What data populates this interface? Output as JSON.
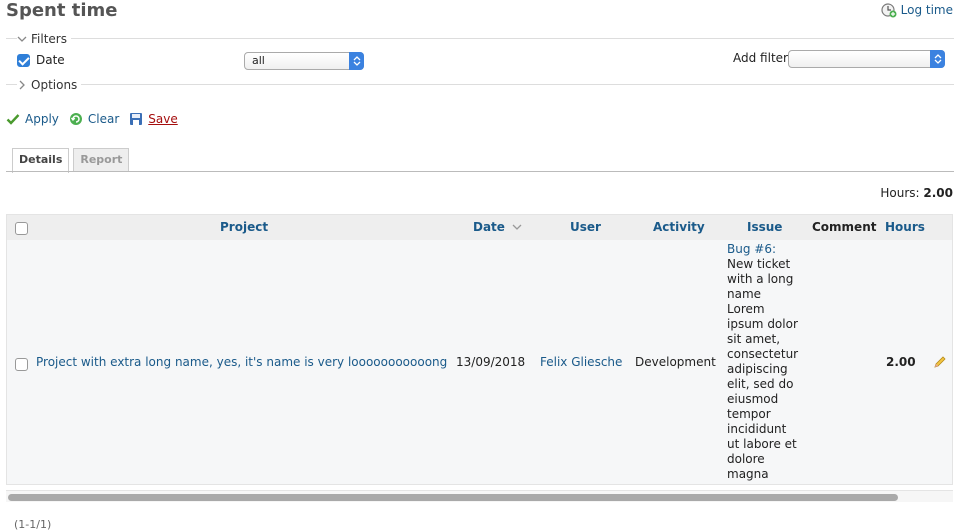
{
  "page": {
    "title": "Spent time",
    "log_time_label": "Log time"
  },
  "filters": {
    "legend": "Filters",
    "date_label": "Date",
    "date_checked": true,
    "date_operator": "all",
    "add_filter_label": "Add filter",
    "add_filter_value": ""
  },
  "options": {
    "legend": "Options"
  },
  "actions": {
    "apply": "Apply",
    "clear": "Clear",
    "save": "Save"
  },
  "tabs": [
    {
      "label": "Details",
      "active": true
    },
    {
      "label": "Report",
      "active": false
    }
  ],
  "total": {
    "label": "Hours:",
    "value": "2.00"
  },
  "table": {
    "columns": [
      "Project",
      "Date",
      "User",
      "Activity",
      "Issue",
      "Comment",
      "Hours"
    ],
    "rows": [
      {
        "project": "Project with extra long name, yes, it's name is very looooooooooong",
        "date": "13/09/2018",
        "user": "Felix Gliesche",
        "activity": "Development",
        "issue_link": "Bug #6:",
        "issue_lines": [
          "New ticket",
          "with a long",
          "name",
          "Lorem",
          "ipsum dolor",
          "sit amet,",
          "consectetur",
          "adipiscing",
          "elit, sed do",
          "eiusmod",
          "tempor",
          "incididunt",
          "ut labore et",
          "dolore",
          "magna"
        ],
        "comment": "",
        "hours": "2.00"
      }
    ]
  },
  "pagination": "(1-1/1)",
  "colors": {
    "link": "#1a5a8a",
    "save": "#a50e0e",
    "accent": "#3b82e0"
  }
}
